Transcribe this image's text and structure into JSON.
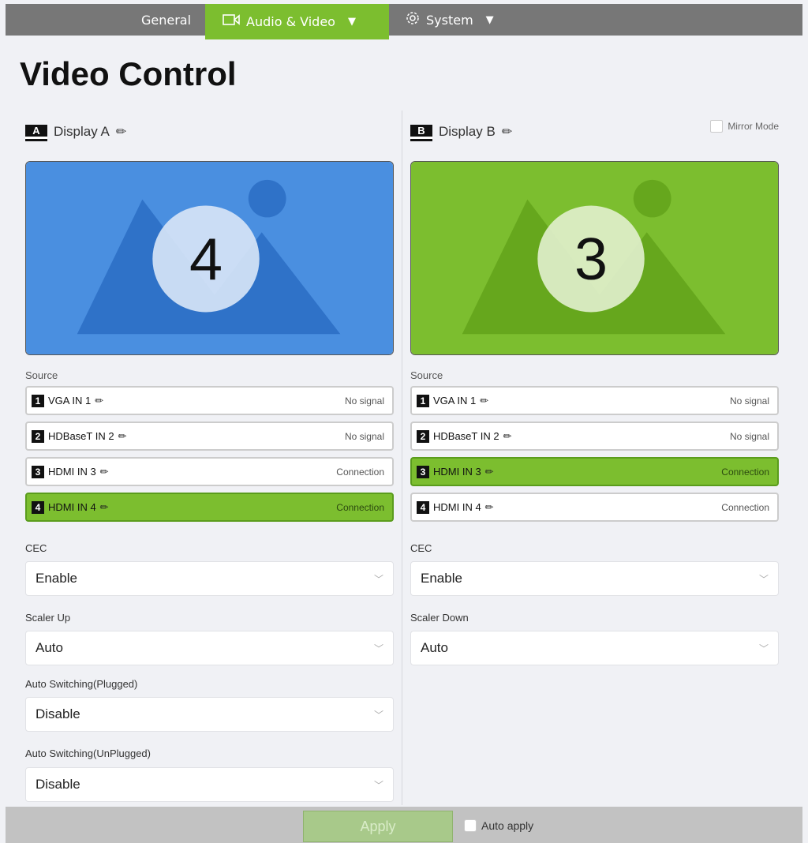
{
  "nav": {
    "general": "General",
    "audio_video": "Audio & Video",
    "system": "System"
  },
  "page_title": "Video Control",
  "display_a": {
    "badge": "A",
    "name": "Display A",
    "preview_number": "4",
    "preview_color": "#4a8fe0",
    "source_label": "Source",
    "sources": [
      {
        "num": "1",
        "name": "VGA IN 1",
        "status": "No signal",
        "active": false
      },
      {
        "num": "2",
        "name": "HDBaseT IN 2",
        "status": "No signal",
        "active": false
      },
      {
        "num": "3",
        "name": "HDMI IN 3",
        "status": "Connection",
        "active": false
      },
      {
        "num": "4",
        "name": "HDMI IN 4",
        "status": "Connection",
        "active": true
      }
    ],
    "cec_label": "CEC",
    "cec_value": "Enable",
    "scaler_label": "Scaler Up",
    "scaler_value": "Auto",
    "auto_plugged_label": "Auto Switching(Plugged)",
    "auto_plugged_value": "Disable",
    "auto_unplugged_label": "Auto Switching(UnPlugged)",
    "auto_unplugged_value": "Disable"
  },
  "display_b": {
    "badge": "B",
    "name": "Display B",
    "mirror_label": "Mirror Mode",
    "preview_number": "3",
    "preview_color": "#7cbe2f",
    "source_label": "Source",
    "sources": [
      {
        "num": "1",
        "name": "VGA IN 1",
        "status": "No signal",
        "active": false
      },
      {
        "num": "2",
        "name": "HDBaseT IN 2",
        "status": "No signal",
        "active": false
      },
      {
        "num": "3",
        "name": "HDMI IN 3",
        "status": "Connection",
        "active": true
      },
      {
        "num": "4",
        "name": "HDMI IN 4",
        "status": "Connection",
        "active": false
      }
    ],
    "cec_label": "CEC",
    "cec_value": "Enable",
    "scaler_label": "Scaler Down",
    "scaler_value": "Auto"
  },
  "footer": {
    "apply_label": "Apply",
    "auto_apply_label": "Auto apply"
  },
  "colors": {
    "accent": "#7cbe2f",
    "nav_bg": "#777777",
    "display_a": "#4a8fe0",
    "display_b": "#7cbe2f"
  }
}
